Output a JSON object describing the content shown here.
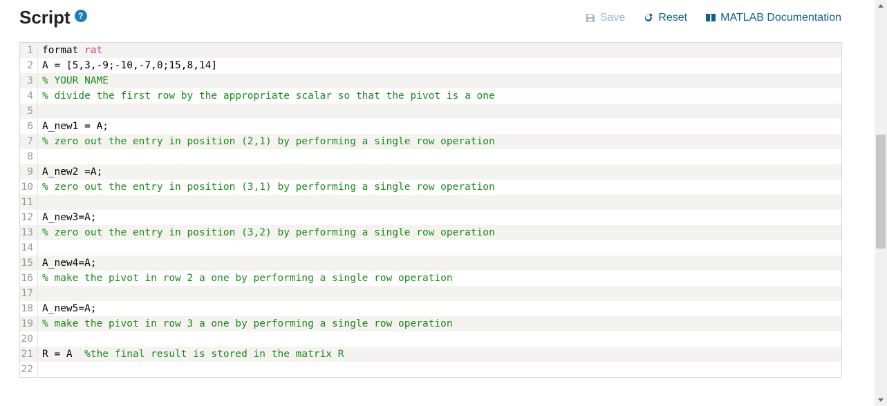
{
  "header": {
    "title": "Script",
    "help_tooltip": "?",
    "save_label": "Save",
    "reset_label": "Reset",
    "docs_label": "MATLAB Documentation"
  },
  "editor": {
    "lines": [
      {
        "n": 1,
        "stripe": true,
        "tokens": [
          {
            "t": "format ",
            "c": "kw"
          },
          {
            "t": "rat",
            "c": "fn"
          }
        ]
      },
      {
        "n": 2,
        "stripe": false,
        "tokens": [
          {
            "t": "A = [5,3,-9;-10,-7,0;15,8,14]",
            "c": "kw"
          }
        ]
      },
      {
        "n": 3,
        "stripe": true,
        "tokens": [
          {
            "t": "% YOUR NAME",
            "c": "cm"
          }
        ]
      },
      {
        "n": 4,
        "stripe": false,
        "tokens": [
          {
            "t": "% divide the first row by the appropriate scalar so that the pivot is a one",
            "c": "cm"
          }
        ]
      },
      {
        "n": 5,
        "stripe": true,
        "tokens": [
          {
            "t": "",
            "c": "kw"
          }
        ]
      },
      {
        "n": 6,
        "stripe": false,
        "tokens": [
          {
            "t": "A_new1 = A;",
            "c": "kw"
          }
        ]
      },
      {
        "n": 7,
        "stripe": true,
        "tokens": [
          {
            "t": "% zero out the entry in position (2,1) by performing a single row operation",
            "c": "cm"
          }
        ]
      },
      {
        "n": 8,
        "stripe": false,
        "tokens": [
          {
            "t": "",
            "c": "kw"
          }
        ]
      },
      {
        "n": 9,
        "stripe": true,
        "tokens": [
          {
            "t": "A_new2 =A;",
            "c": "kw"
          }
        ]
      },
      {
        "n": 10,
        "stripe": false,
        "tokens": [
          {
            "t": "% zero out the entry in position (3,1) by performing a single row operation",
            "c": "cm"
          }
        ]
      },
      {
        "n": 11,
        "stripe": true,
        "tokens": [
          {
            "t": "",
            "c": "kw"
          }
        ]
      },
      {
        "n": 12,
        "stripe": false,
        "tokens": [
          {
            "t": "A_new3=A;",
            "c": "kw"
          }
        ]
      },
      {
        "n": 13,
        "stripe": true,
        "tokens": [
          {
            "t": "% zero out the entry in position (3,2) by performing a single row operation",
            "c": "cm"
          }
        ]
      },
      {
        "n": 14,
        "stripe": false,
        "tokens": [
          {
            "t": "",
            "c": "kw"
          }
        ]
      },
      {
        "n": 15,
        "stripe": true,
        "tokens": [
          {
            "t": "A_new4=A;",
            "c": "kw"
          }
        ]
      },
      {
        "n": 16,
        "stripe": false,
        "tokens": [
          {
            "t": "% make the pivot in row 2 a one by performing a single row operation",
            "c": "cm"
          }
        ]
      },
      {
        "n": 17,
        "stripe": true,
        "tokens": [
          {
            "t": "",
            "c": "kw"
          }
        ]
      },
      {
        "n": 18,
        "stripe": false,
        "tokens": [
          {
            "t": "A_new5=A;",
            "c": "kw"
          }
        ]
      },
      {
        "n": 19,
        "stripe": true,
        "tokens": [
          {
            "t": "% make the pivot in row 3 a one by performing a single row operation",
            "c": "cm"
          }
        ]
      },
      {
        "n": 20,
        "stripe": false,
        "tokens": [
          {
            "t": "",
            "c": "kw"
          }
        ]
      },
      {
        "n": 21,
        "stripe": true,
        "tokens": [
          {
            "t": "R = A  ",
            "c": "kw"
          },
          {
            "t": "%the final result is stored in the matrix R",
            "c": "cm"
          }
        ]
      },
      {
        "n": 22,
        "stripe": false,
        "tokens": [
          {
            "t": "",
            "c": "kw"
          }
        ]
      }
    ]
  }
}
